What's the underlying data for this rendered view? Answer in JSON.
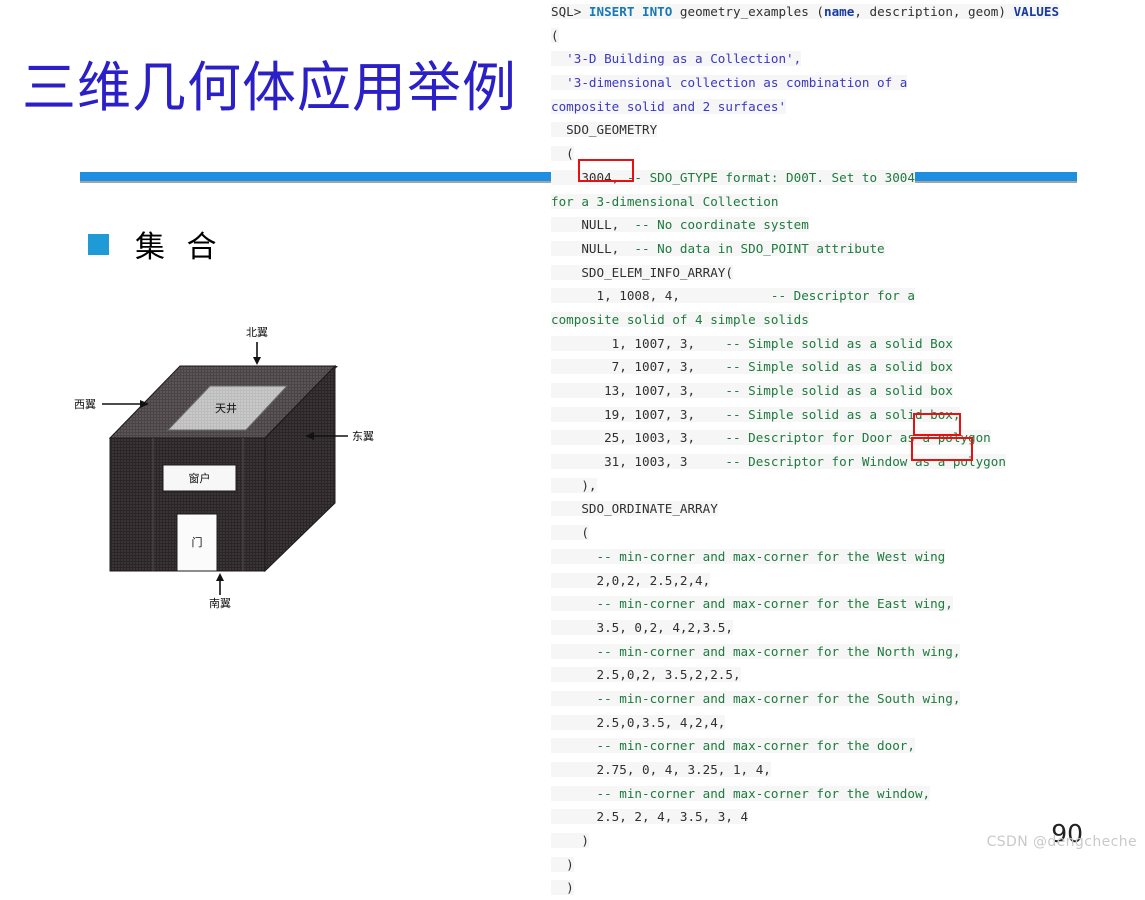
{
  "slide": {
    "title": "三维几何体应用举例",
    "bullet": "集 合",
    "page_number": "90",
    "watermark": "CSDN @dengcheche",
    "accent_color": "#1E8FE0",
    "title_color": "#2B20C8",
    "bullet_color": "#1E9BD7"
  },
  "diagram": {
    "name": "3d-building-collection",
    "labels": {
      "north": "北翼",
      "west": "西翼",
      "east": "东翼",
      "south": "南翼",
      "atrium": "天井",
      "window": "窗户",
      "door": "门"
    }
  },
  "annotations": {
    "highlight_color": "#E81010",
    "boxes": [
      "3004,",
      "Door",
      "Window"
    ]
  },
  "code": {
    "lines": [
      [
        {
          "t": "SQL> ",
          "c": "plain"
        },
        {
          "t": "INSERT INTO",
          "c": "kw"
        },
        {
          "t": " geometry_examples (",
          "c": "plain"
        },
        {
          "t": "name",
          "c": "kwd"
        },
        {
          "t": ", description, geom) ",
          "c": "plain"
        },
        {
          "t": "VALUES",
          "c": "kwd"
        }
      ],
      [
        {
          "t": "(",
          "c": "plain"
        }
      ],
      [
        {
          "t": "  '3-D Building as a Collection',",
          "c": "str"
        }
      ],
      [
        {
          "t": "  '3-dimensional collection as combination of a",
          "c": "str"
        }
      ],
      [
        {
          "t": "composite solid and 2 surfaces'",
          "c": "str"
        }
      ],
      [
        {
          "t": "  SDO_GEOMETRY",
          "c": "plain"
        }
      ],
      [
        {
          "t": "  (",
          "c": "plain"
        }
      ],
      [
        {
          "t": "    3004, ",
          "c": "num"
        },
        {
          "t": "-- SDO_GTYPE format: D00T. Set to 3004",
          "c": "cmt"
        }
      ],
      [
        {
          "t": "for a 3-dimensional Collection",
          "c": "cmt"
        }
      ],
      [
        {
          "t": "    NULL,  ",
          "c": "plain"
        },
        {
          "t": "-- No coordinate system",
          "c": "cmt"
        }
      ],
      [
        {
          "t": "    NULL,  ",
          "c": "plain"
        },
        {
          "t": "-- No data in SDO_POINT attribute",
          "c": "cmt"
        }
      ],
      [
        {
          "t": "    SDO_ELEM_INFO_ARRAY(",
          "c": "plain"
        }
      ],
      [
        {
          "t": "      1, 1008, 4,            ",
          "c": "num"
        },
        {
          "t": "-- Descriptor for a",
          "c": "cmt"
        }
      ],
      [
        {
          "t": "composite solid of 4 simple solids",
          "c": "cmt"
        }
      ],
      [
        {
          "t": "        1, 1007, 3,    ",
          "c": "num"
        },
        {
          "t": "-- Simple solid as a solid Box",
          "c": "cmt"
        }
      ],
      [
        {
          "t": "        7, 1007, 3,    ",
          "c": "num"
        },
        {
          "t": "-- Simple solid as a solid box",
          "c": "cmt"
        }
      ],
      [
        {
          "t": "       13, 1007, 3,    ",
          "c": "num"
        },
        {
          "t": "-- Simple solid as a solid box",
          "c": "cmt"
        }
      ],
      [
        {
          "t": "       19, 1007, 3,    ",
          "c": "num"
        },
        {
          "t": "-- Simple solid as a solid box,",
          "c": "cmt"
        }
      ],
      [
        {
          "t": "       25, 1003, 3,    ",
          "c": "num"
        },
        {
          "t": "-- Descriptor for Door as a polygon",
          "c": "cmt"
        }
      ],
      [
        {
          "t": "       31, 1003, 3     ",
          "c": "num"
        },
        {
          "t": "-- Descriptor for Window as a polygon",
          "c": "cmt"
        }
      ],
      [
        {
          "t": "    ),",
          "c": "plain"
        }
      ],
      [
        {
          "t": "    SDO_ORDINATE_ARRAY",
          "c": "plain"
        }
      ],
      [
        {
          "t": "    (",
          "c": "plain"
        }
      ],
      [
        {
          "t": "      -- min-corner and max-corner for the West wing",
          "c": "cmt"
        }
      ],
      [
        {
          "t": "      2,0,2, 2.5,2,4,",
          "c": "num"
        }
      ],
      [
        {
          "t": "      -- min-corner and max-corner for the East wing,",
          "c": "cmt"
        }
      ],
      [
        {
          "t": "      3.5, 0,2, 4,2,3.5,",
          "c": "num"
        }
      ],
      [
        {
          "t": "      -- min-corner and max-corner for the North wing,",
          "c": "cmt"
        }
      ],
      [
        {
          "t": "      2.5,0,2, 3.5,2,2.5,",
          "c": "num"
        }
      ],
      [
        {
          "t": "      -- min-corner and max-corner for the South wing,",
          "c": "cmt"
        }
      ],
      [
        {
          "t": "      2.5,0,3.5, 4,2,4,",
          "c": "num"
        }
      ],
      [
        {
          "t": "      -- min-corner and max-corner for the door,",
          "c": "cmt"
        }
      ],
      [
        {
          "t": "      2.75, 0, 4, 3.25, 1, 4,",
          "c": "num"
        }
      ],
      [
        {
          "t": "      -- min-corner and max-corner for the window,",
          "c": "cmt"
        }
      ],
      [
        {
          "t": "      2.5, 2, 4, 3.5, 3, 4",
          "c": "num"
        }
      ],
      [
        {
          "t": "    )",
          "c": "plain"
        }
      ],
      [
        {
          "t": "  )",
          "c": "plain"
        }
      ],
      [
        {
          "t": "  )",
          "c": "plain"
        }
      ]
    ]
  }
}
